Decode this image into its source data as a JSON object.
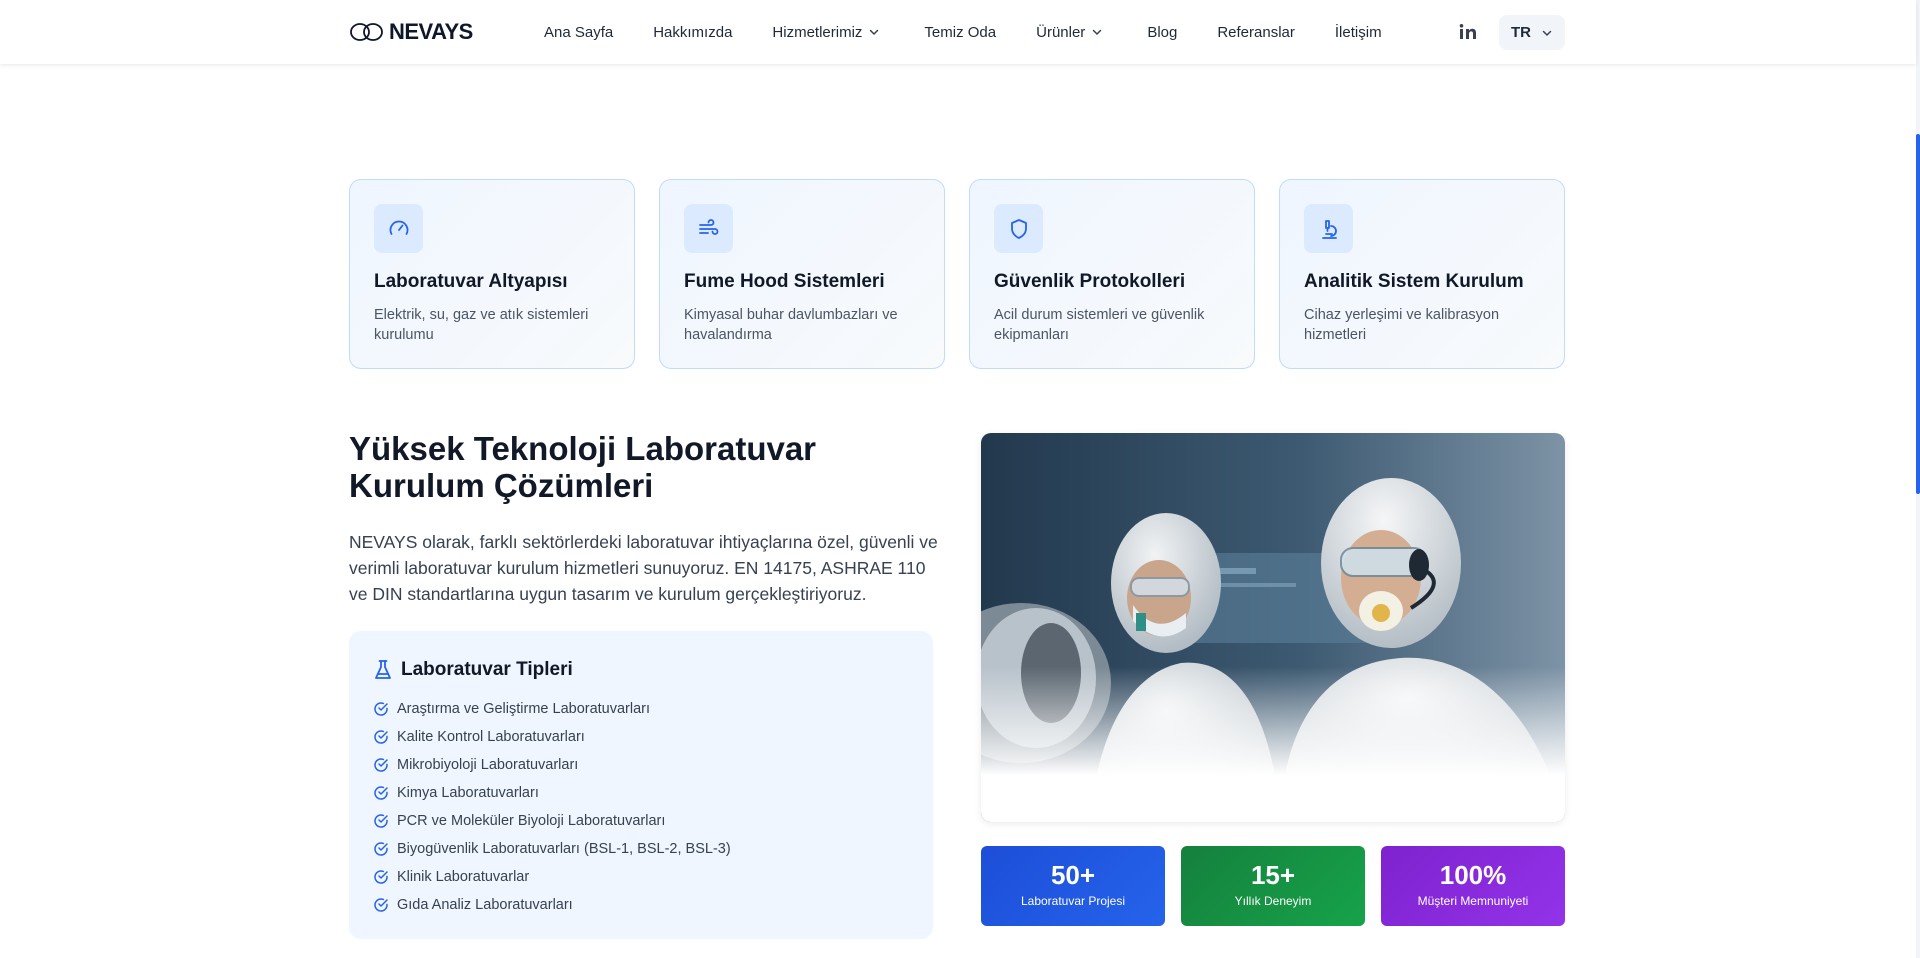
{
  "header": {
    "logo_text": "NEVAYS",
    "nav": [
      {
        "label": "Ana Sayfa"
      },
      {
        "label": "Hakkımızda"
      },
      {
        "label": "Hizmetlerimiz"
      },
      {
        "label": "Temiz Oda"
      },
      {
        "label": "Ürünler"
      },
      {
        "label": "Blog"
      },
      {
        "label": "Referanslar"
      },
      {
        "label": "İletişim"
      }
    ],
    "language": "TR"
  },
  "features": [
    {
      "icon": "gauge-icon",
      "title": "Laboratuvar Altyapısı",
      "desc": "Elektrik, su, gaz ve atık sistemleri kurulumu"
    },
    {
      "icon": "wind-icon",
      "title": "Fume Hood Sistemleri",
      "desc": "Kimyasal buhar davlumbazları ve havalandırma"
    },
    {
      "icon": "shield-icon",
      "title": "Güvenlik Protokolleri",
      "desc": "Acil durum sistemleri ve güvenlik ekipmanları"
    },
    {
      "icon": "microscope-icon",
      "title": "Analitik Sistem Kurulum",
      "desc": "Cihaz yerleşimi ve kalibrasyon hizmetleri"
    }
  ],
  "main": {
    "headline": "Yüksek Teknoloji Laboratuvar Kurulum Çözümleri",
    "intro": "NEVAYS olarak, farklı sektörlerdeki laboratuvar ihtiyaçlarına özel, güvenli ve verimli laboratuvar kurulum hizmetleri sunuyoruz. EN 14175, ASHRAE 110 ve DIN standartlarına uygun tasarım ve kurulum gerçekleştiriyoruz.",
    "types_title": "Laboratuvar Tipleri",
    "types": [
      "Araştırma ve Geliştirme Laboratuvarları",
      "Kalite Kontrol Laboratuvarları",
      "Mikrobiyoloji Laboratuvarları",
      "Kimya Laboratuvarları",
      "PCR ve Moleküler Biyoloji Laboratuvarları",
      "Biyogüvenlik Laboratuvarları (BSL-1, BSL-2, BSL-3)",
      "Klinik Laboratuvarlar",
      "Gıda Analiz Laboratuvarları"
    ]
  },
  "stats": [
    {
      "value": "50+",
      "label": "Laboratuvar Projesi",
      "color": "#1d4ed8"
    },
    {
      "value": "15+",
      "label": "Yıllık Deneyim",
      "color": "#15803d"
    },
    {
      "value": "100%",
      "label": "Müşteri Memnuniyeti",
      "color": "#7e22ce"
    }
  ],
  "colors": {
    "accent": "#2563eb",
    "card_border": "#bfdbfe",
    "card_icon_bg": "#dbeafe",
    "types_bg": "#eff6ff"
  }
}
